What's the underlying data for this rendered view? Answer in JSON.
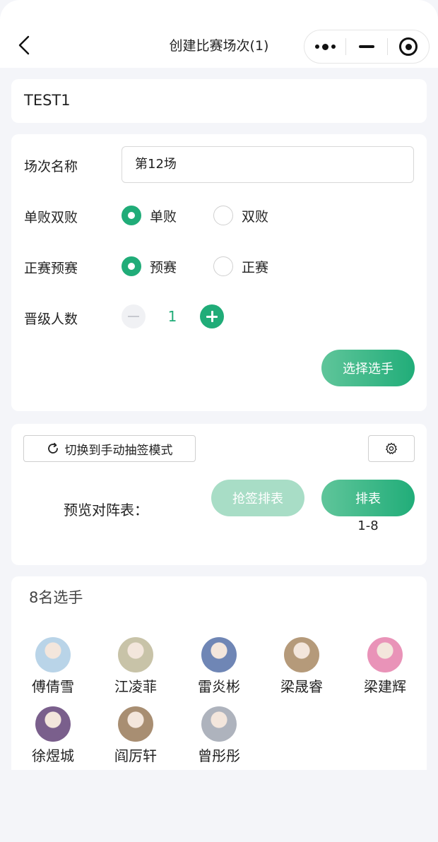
{
  "nav": {
    "title": "创建比赛场次(1)"
  },
  "event": {
    "title": "TEST1"
  },
  "form": {
    "session_label": "场次名称",
    "session_value": "第12场",
    "elim_label": "单败双败",
    "elim_options": [
      "单败",
      "双败"
    ],
    "elim_selected": "单败",
    "stage_label": "正赛预赛",
    "stage_options": [
      "预赛",
      "正赛"
    ],
    "stage_selected": "预赛",
    "advance_label": "晋级人数",
    "advance_value": "1",
    "select_players_label": "选择选手"
  },
  "draw": {
    "mode_button_label": "切换到手动抽签模式",
    "preview_label": "预览对阵表：",
    "grab_draw_label": "抢签排表",
    "schedule_label": "排表",
    "range": "1-8"
  },
  "players": {
    "title": "8名选手",
    "list": [
      {
        "name": "傅倩雪",
        "avatar_color": "#b9d4e8"
      },
      {
        "name": "江凌菲",
        "avatar_color": "#c8c3a8"
      },
      {
        "name": "雷炎彬",
        "avatar_color": "#6f86b5"
      },
      {
        "name": "梁晟睿",
        "avatar_color": "#b59a7a"
      },
      {
        "name": "梁建辉",
        "avatar_color": "#e993b8"
      },
      {
        "name": "徐煜城",
        "avatar_color": "#7a5f8c"
      },
      {
        "name": "阎厉轩",
        "avatar_color": "#a88e72"
      },
      {
        "name": "曾彤彤",
        "avatar_color": "#aeb3bd"
      }
    ]
  },
  "colors": {
    "accent": "#20ac78",
    "accent_light": "#a8ddc6",
    "background": "#f4f5f9"
  }
}
